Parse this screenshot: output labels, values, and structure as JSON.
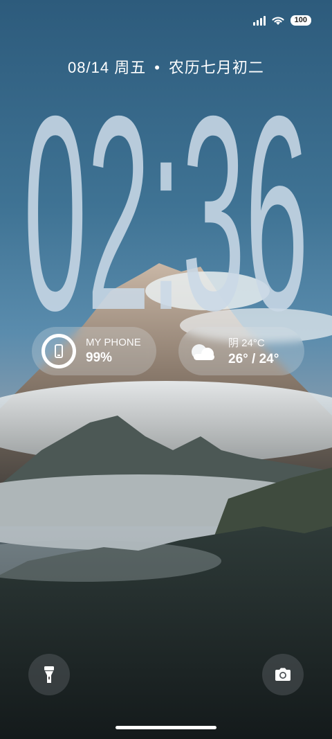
{
  "status_bar": {
    "battery_level": "100",
    "icons": [
      "signal-icon",
      "wifi-icon",
      "battery-icon"
    ]
  },
  "lock_screen": {
    "date": "08/14 周五",
    "separator": "•",
    "lunar_date": "农历七月初二",
    "time": "02:36"
  },
  "widgets": {
    "phone": {
      "title": "MY PHONE",
      "value": "99%",
      "icon": "phone-battery-ring-icon"
    },
    "weather": {
      "title": "阴 24°C",
      "value": "26° / 24°",
      "icon": "cloud-icon"
    }
  },
  "shortcuts": {
    "left_icon": "flashlight-icon",
    "right_icon": "camera-icon"
  },
  "colors": {
    "clock_digits": "#c9d8e6",
    "widget_bg": "rgba(220,225,230,0.28)"
  }
}
